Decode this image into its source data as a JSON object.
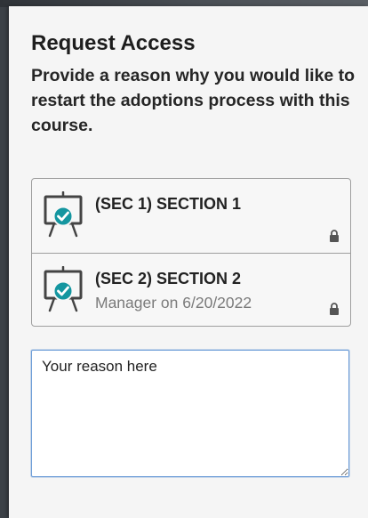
{
  "dialog": {
    "title": "Request Access",
    "description": "Provide a reason why you would like to restart the adoptions process with this course."
  },
  "sections": [
    {
      "name": "(SEC 1) SECTION 1",
      "meta": "",
      "icon": "easel-check-icon",
      "lock_icon": "lock-icon"
    },
    {
      "name": "(SEC 2) SECTION 2",
      "meta": "Manager on 6/20/2022",
      "icon": "easel-check-icon",
      "lock_icon": "lock-icon"
    }
  ],
  "reason_field": {
    "placeholder": "Your reason here",
    "value": ""
  },
  "colors": {
    "panel_bg": "#f5f5f5",
    "backdrop": "#3c4147",
    "accent_teal": "#1496a0",
    "focus_border": "#6f9ed8"
  }
}
